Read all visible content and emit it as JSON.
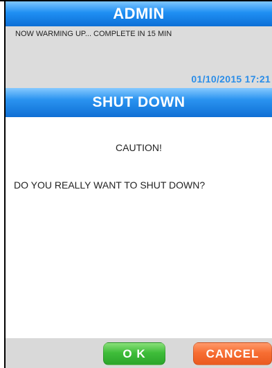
{
  "header": {
    "title": "ADMIN"
  },
  "status": {
    "message": "NOW WARMING UP... COMPLETE IN 15 MIN",
    "datetime": "01/10/2015 17:21"
  },
  "dialog": {
    "title": "SHUT DOWN",
    "caution": "CAUTION!",
    "question": "DO YOU REALLY WANT TO SHUT DOWN?"
  },
  "buttons": {
    "ok_label": "O K",
    "cancel_label": "CANCEL"
  },
  "colors": {
    "title_blue": "#1f8ff3",
    "datetime_blue": "#2a8de8",
    "ok_green": "#3fbd3a",
    "cancel_orange": "#f76e33",
    "panel_gray": "#dcdcdc"
  }
}
